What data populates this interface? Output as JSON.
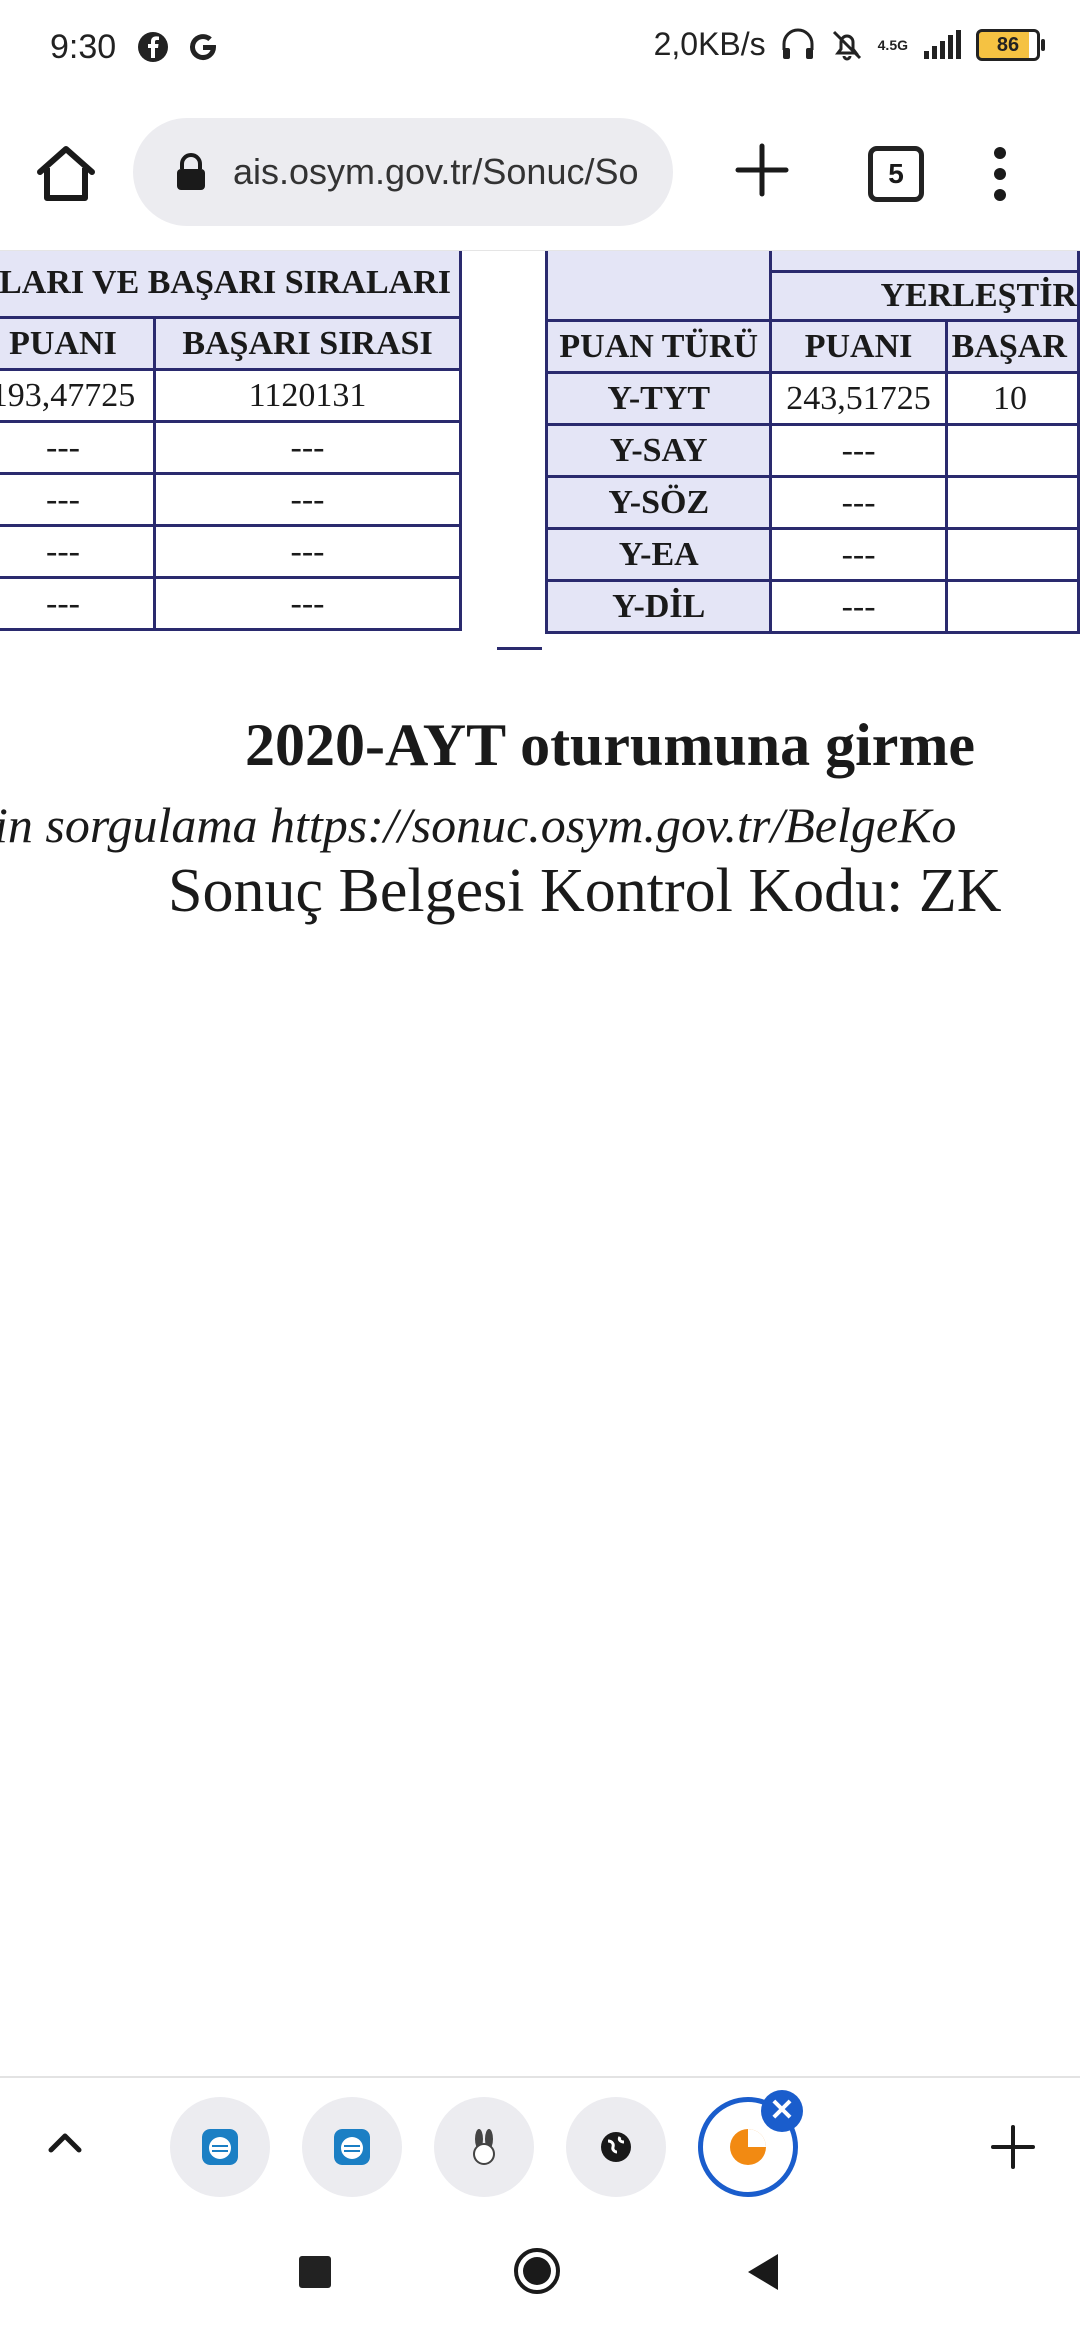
{
  "status_bar": {
    "time": "9:30",
    "speed": "2,0KB/s",
    "network": "4.5G",
    "battery": "86"
  },
  "browser": {
    "url": "ais.osym.gov.tr/Sonuc/So",
    "tab_count": "5"
  },
  "left_table": {
    "group_header": "LARI VE BAŞARI SIRALARI",
    "col_puani": "PUANI",
    "col_sira": "BAŞARI SIRASI",
    "rows": [
      {
        "puan": "193,47725",
        "sira": "1120131"
      },
      {
        "puan": "---",
        "sira": "---"
      },
      {
        "puan": "---",
        "sira": "---"
      },
      {
        "puan": "---",
        "sira": "---"
      },
      {
        "puan": "---",
        "sira": "---"
      }
    ]
  },
  "right_table": {
    "group_header": "YERLEŞTİR",
    "col_tur": "PUAN TÜRÜ",
    "col_puani": "PUANI",
    "col_sira": "BAŞAR",
    "rows": [
      {
        "tur": "Y-TYT",
        "puan": "243,51725",
        "sira": "10"
      },
      {
        "tur": "Y-SAY",
        "puan": "---",
        "sira": ""
      },
      {
        "tur": "Y-SÖZ",
        "puan": "---",
        "sira": ""
      },
      {
        "tur": "Y-EA",
        "puan": "---",
        "sira": ""
      },
      {
        "tur": "Y-DİL",
        "puan": "---",
        "sira": ""
      }
    ]
  },
  "content": {
    "notice": "2020-AYT oturumuna girme",
    "verify_text": "in sorgulama https://sonuc.osym.gov.tr/BelgeKo",
    "control_code": "Sonuç Belgesi Kontrol Kodu: ZK"
  },
  "colors": {
    "table_border": "#2a2a6e",
    "header_bg": "#e4e5f6",
    "accent": "#1a5dcc"
  }
}
